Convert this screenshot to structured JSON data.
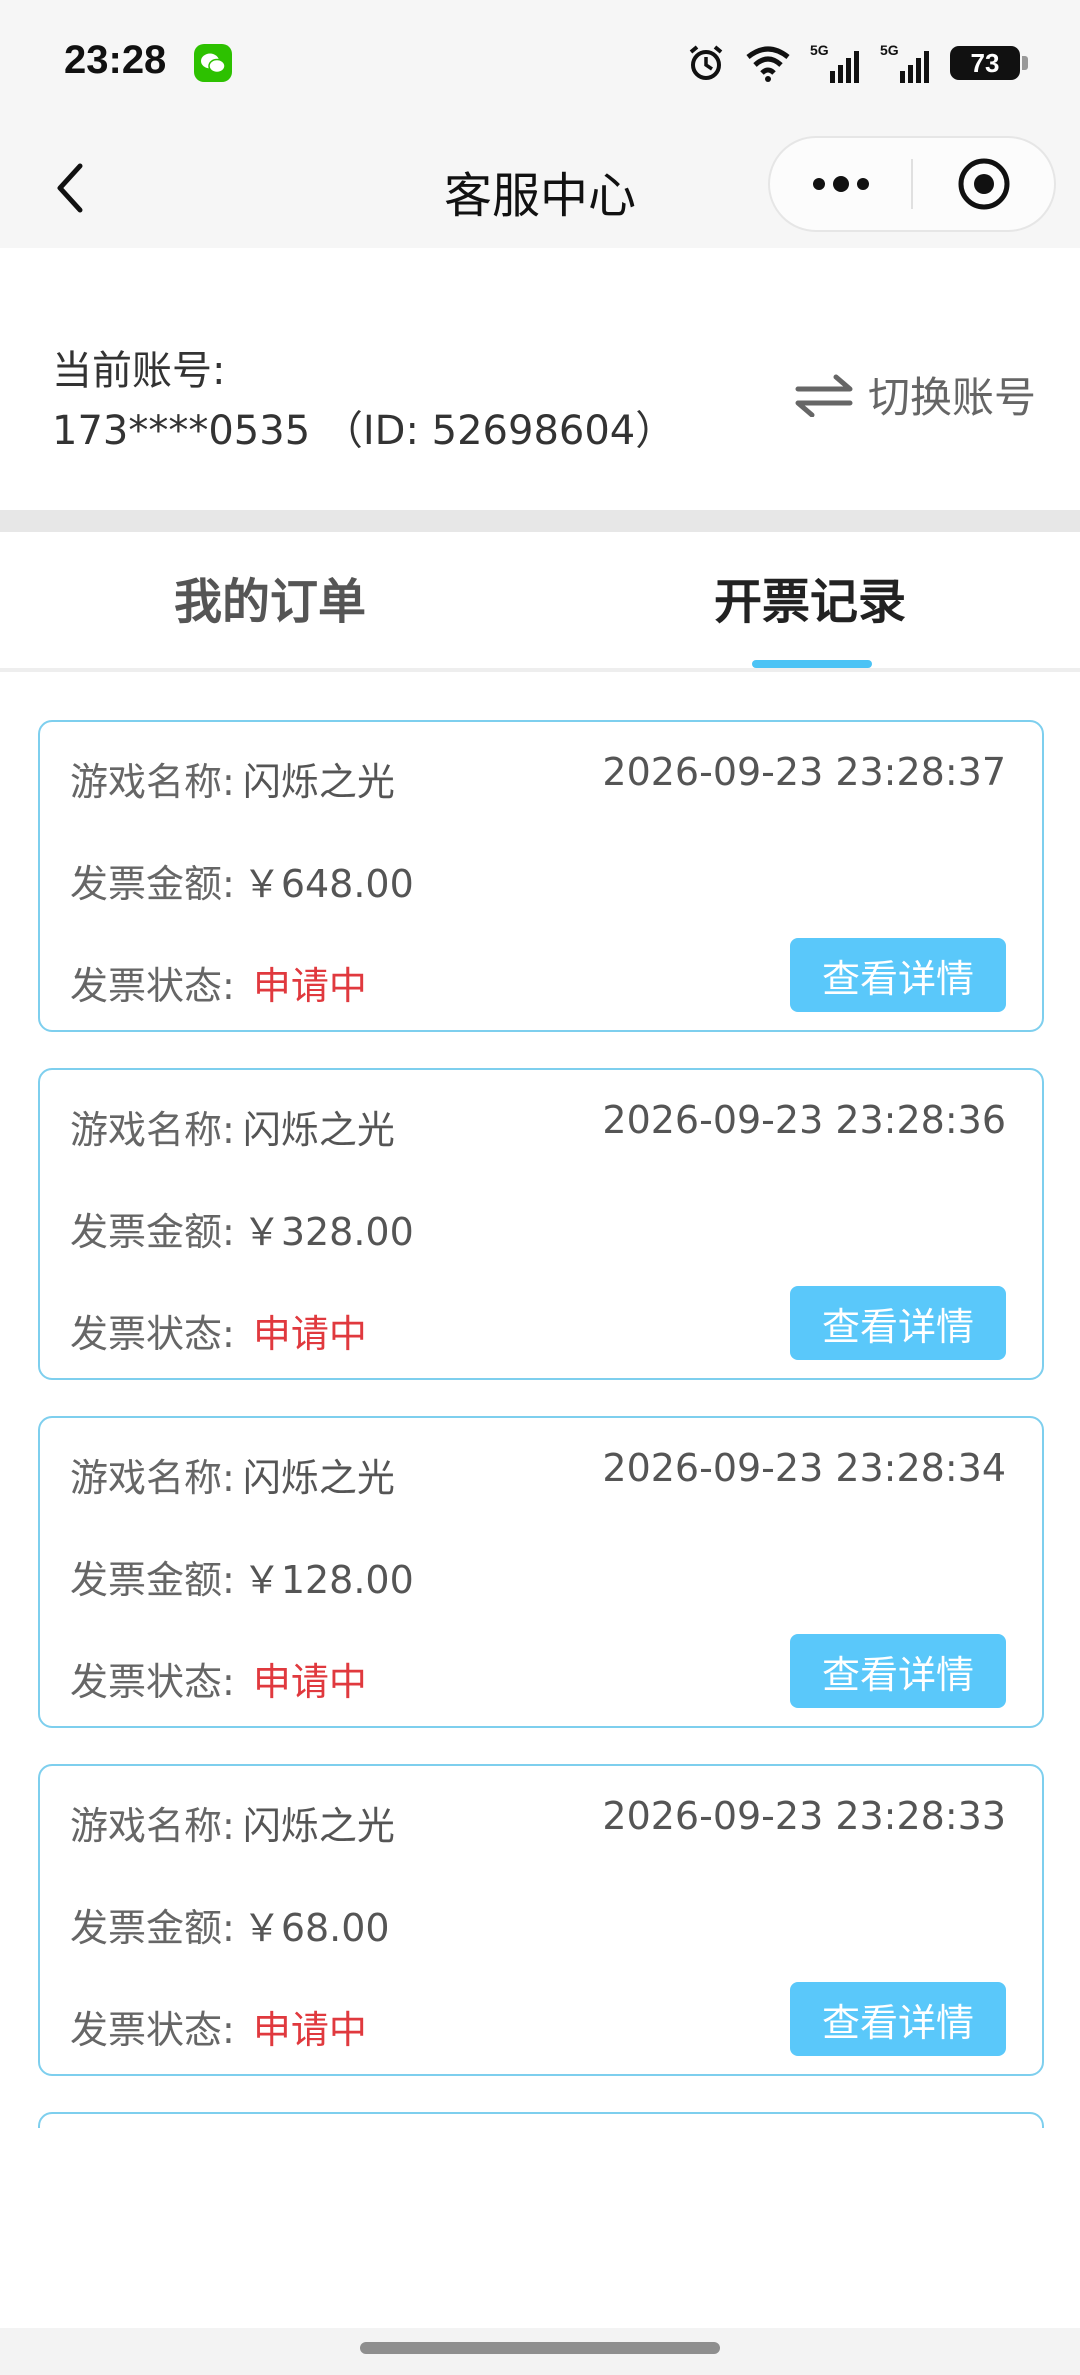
{
  "status_bar": {
    "time": "23:28",
    "icons": [
      "wechat-icon",
      "alarm-icon",
      "wifi-icon",
      "signal-5g-icon",
      "signal-5g-icon"
    ],
    "battery": "73"
  },
  "nav": {
    "title": "客服中心"
  },
  "account": {
    "label": "当前账号:",
    "value": "173****0535 （ID: 52698604）",
    "switch_label": "切换账号"
  },
  "tabs": [
    {
      "label": "我的订单",
      "active": false
    },
    {
      "label": "开票记录",
      "active": true
    }
  ],
  "records": [
    {
      "game_label": "游戏名称:",
      "game_name": "闪烁之光",
      "time": "2026-09-23 23:28:37",
      "amount_label": "发票金额:",
      "amount": "￥648.00",
      "status_label": "发票状态:",
      "status": "申请中",
      "button": "查看详情"
    },
    {
      "game_label": "游戏名称:",
      "game_name": "闪烁之光",
      "time": "2026-09-23 23:28:36",
      "amount_label": "发票金额:",
      "amount": "￥328.00",
      "status_label": "发票状态:",
      "status": "申请中",
      "button": "查看详情"
    },
    {
      "game_label": "游戏名称:",
      "game_name": "闪烁之光",
      "time": "2026-09-23 23:28:34",
      "amount_label": "发票金额:",
      "amount": "￥128.00",
      "status_label": "发票状态:",
      "status": "申请中",
      "button": "查看详情"
    },
    {
      "game_label": "游戏名称:",
      "game_name": "闪烁之光",
      "time": "2026-09-23 23:28:33",
      "amount_label": "发票金额:",
      "amount": "￥68.00",
      "status_label": "发票状态:",
      "status": "申请中",
      "button": "查看详情"
    }
  ],
  "colors": {
    "accent": "#5ac8fa",
    "card_border": "#7ecfee",
    "status_red": "#e0393e",
    "tab_indicator": "#4cc3f5"
  }
}
